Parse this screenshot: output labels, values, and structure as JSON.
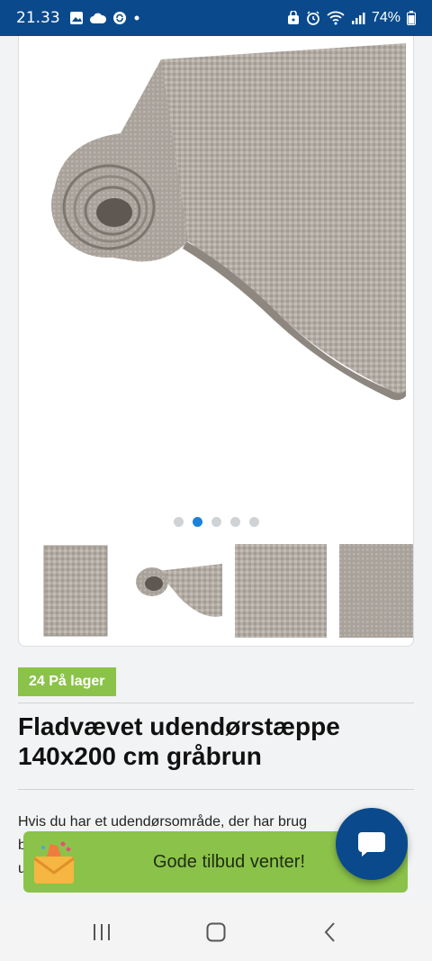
{
  "status_bar": {
    "time": "21.33",
    "battery": "74%",
    "icons": [
      "image-icon",
      "cloud-icon",
      "sync-icon",
      "dot-icon",
      "alarm-lock-icon",
      "alarm-icon",
      "wifi-icon",
      "signal-icon",
      "battery-icon"
    ]
  },
  "colors": {
    "status_bar": "#0a4a8c",
    "accent_green": "#8bc34a",
    "active_dot": "#1a82d8",
    "chat_button": "#0a4a8c"
  },
  "gallery": {
    "dot_count": 5,
    "active_dot_index": 1,
    "thumbnails": [
      "rug-flat-thumbnail",
      "rug-rolled-thumbnail",
      "rug-texture-thumbnail",
      "rug-closeup-thumbnail"
    ]
  },
  "product": {
    "stock_badge": "24 På lager",
    "title_line1": "Fladvævet udendørstæppe",
    "title_line2": "140x200 cm gråbrun",
    "description_line1": "Hvis du har et udendørsområde, der har brug",
    "description_line2": "b",
    "description_line3": "u"
  },
  "promo": {
    "text": "Gode tilbud venter!",
    "icon": "gift-envelope-icon"
  },
  "chat": {
    "icon": "chat-bubble-icon"
  },
  "nav_bar": {
    "buttons": [
      "recent-apps-icon",
      "home-icon",
      "back-icon"
    ]
  }
}
